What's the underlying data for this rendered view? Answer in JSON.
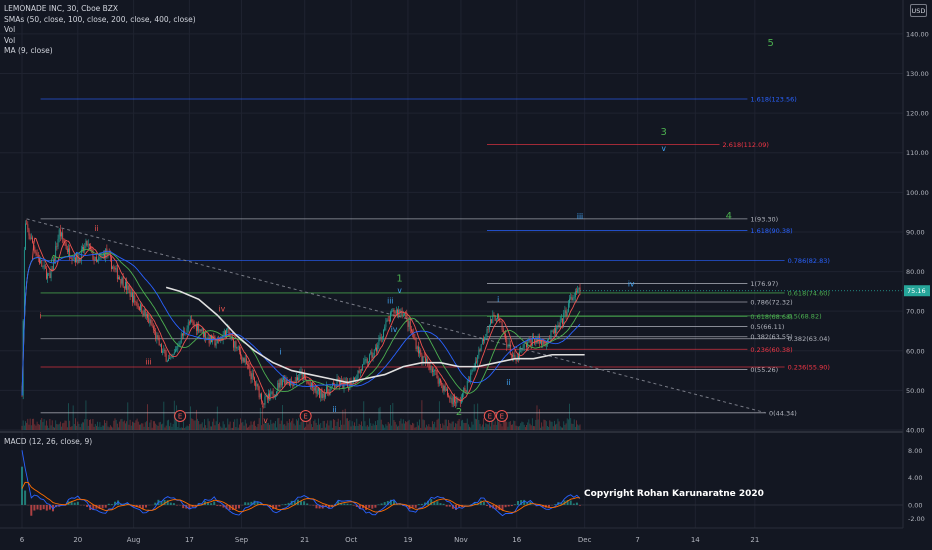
{
  "legend": {
    "title": "LEMONADE INC, 30, Cboe BZX",
    "sma": "SMAs (50, close, 100, close, 200, close, 400, close)",
    "vol1": "Vol",
    "vol2": "Vol",
    "ma": "MA (9, close)"
  },
  "macd_label": "MACD (12, 26, close, 9)",
  "currency": "USD",
  "copyright": "Copyright Rohan Karunaratne 2020",
  "colors": {
    "background": "#131722",
    "grid": "#1f2330",
    "up": "#26a69a",
    "down": "#ef5350",
    "fib_blue": "#2962ff",
    "fib_green": "#4caf50",
    "fib_red": "#f23645",
    "fib_white": "#b2b5be",
    "wave_green": "#4caf50",
    "wave_blue": "#42a5f5",
    "wave_red": "#ef5350",
    "price_tag": "#26a69a"
  },
  "chart_data": {
    "type": "candlestick",
    "symbol": "LEMONADE INC",
    "interval": "30",
    "ylim": [
      40,
      142
    ],
    "y_ticks": [
      "40.00",
      "50.00",
      "60.00",
      "70.00",
      "80.00",
      "90.00",
      "100.00",
      "110.00",
      "120.00",
      "130.00",
      "140.00"
    ],
    "x_ticks": [
      "6",
      "20",
      "Aug",
      "17",
      "Sep",
      "21",
      "Oct",
      "19",
      "Nov",
      "16",
      "Dec",
      "7",
      "14",
      "21"
    ],
    "last_price": "75.16",
    "macd_ylim": [
      -2.2,
      9.5
    ],
    "macd_ticks": [
      "8.00",
      "4.00",
      "0.00",
      "-2.00"
    ],
    "price_path": [
      [
        0,
        50
      ],
      [
        0.3,
        92
      ],
      [
        1,
        88
      ],
      [
        2,
        82
      ],
      [
        3,
        78
      ],
      [
        4,
        90
      ],
      [
        5,
        85
      ],
      [
        6,
        83
      ],
      [
        7,
        87
      ],
      [
        8,
        82
      ],
      [
        9,
        85
      ],
      [
        10,
        80
      ],
      [
        11,
        77
      ],
      [
        12,
        73
      ],
      [
        13,
        70
      ],
      [
        14,
        66
      ],
      [
        15,
        60
      ],
      [
        16,
        57
      ],
      [
        17,
        63
      ],
      [
        18,
        67
      ],
      [
        19,
        66
      ],
      [
        20,
        63
      ],
      [
        21,
        62
      ],
      [
        22,
        65
      ],
      [
        23,
        61
      ],
      [
        24,
        57
      ],
      [
        25,
        52
      ],
      [
        26,
        47
      ],
      [
        27,
        49
      ],
      [
        28,
        53
      ],
      [
        29,
        52
      ],
      [
        30,
        54
      ],
      [
        31,
        51
      ],
      [
        32,
        49
      ],
      [
        33,
        50
      ],
      [
        34,
        52
      ],
      [
        35,
        51
      ],
      [
        36,
        54
      ],
      [
        37,
        57
      ],
      [
        38,
        60
      ],
      [
        39,
        66
      ],
      [
        40,
        70
      ],
      [
        41,
        70
      ],
      [
        42,
        64
      ],
      [
        43,
        58
      ],
      [
        44,
        56
      ],
      [
        45,
        52
      ],
      [
        46,
        48
      ],
      [
        47,
        47
      ],
      [
        48,
        52
      ],
      [
        49,
        59
      ],
      [
        50,
        66
      ],
      [
        51,
        69
      ],
      [
        52,
        63
      ],
      [
        53,
        57
      ],
      [
        54,
        61
      ],
      [
        55,
        63
      ],
      [
        56,
        62
      ],
      [
        57,
        64
      ],
      [
        58,
        67
      ],
      [
        59,
        73
      ],
      [
        60,
        75.16
      ]
    ],
    "bars": 61,
    "sma_white": [
      [
        15.5,
        76
      ],
      [
        17,
        75
      ],
      [
        19,
        73
      ],
      [
        21,
        69
      ],
      [
        23,
        64
      ],
      [
        25,
        60
      ],
      [
        27,
        57
      ],
      [
        29,
        55
      ],
      [
        31,
        54
      ],
      [
        33,
        53
      ],
      [
        35,
        52
      ],
      [
        37,
        53
      ],
      [
        39,
        54
      ],
      [
        41,
        56
      ],
      [
        43,
        57
      ],
      [
        45,
        57
      ],
      [
        47,
        56
      ],
      [
        49,
        56
      ],
      [
        51,
        57
      ],
      [
        53,
        58
      ],
      [
        55,
        58
      ],
      [
        57,
        59
      ],
      [
        59,
        59
      ],
      [
        60.5,
        59
      ]
    ],
    "fib_levels": [
      {
        "label": "1.618(123.56)",
        "price": 123.56,
        "x0": 2,
        "x1": 78,
        "color": "blue"
      },
      {
        "label": "2.618(112.09)",
        "price": 112.09,
        "x0": 50,
        "x1": 75,
        "color": "red"
      },
      {
        "label": "1(93.30)",
        "price": 93.3,
        "x0": 2,
        "x1": 78,
        "color": "white"
      },
      {
        "label": "1.618(90.38)",
        "price": 90.38,
        "x0": 50,
        "x1": 78,
        "color": "blue"
      },
      {
        "label": "0.786(82.83)",
        "price": 82.83,
        "x0": 2,
        "x1": 82,
        "color": "blue"
      },
      {
        "label": "1(76.97)",
        "price": 76.97,
        "x0": 50,
        "x1": 78,
        "color": "white"
      },
      {
        "label": "0.618(74.60)",
        "price": 74.6,
        "x0": 2,
        "x1": 82,
        "color": "green"
      },
      {
        "label": "0.786(72.32)",
        "price": 72.32,
        "x0": 50,
        "x1": 78,
        "color": "white"
      },
      {
        "label": "0.618(68.68)",
        "price": 68.68,
        "x0": 50,
        "x1": 78,
        "color": "green"
      },
      {
        "label": "0.5(68.82)",
        "price": 68.82,
        "x0": 2,
        "x1": 82,
        "color": "green"
      },
      {
        "label": "0.5(66.11)",
        "price": 66.11,
        "x0": 50,
        "x1": 78,
        "color": "white"
      },
      {
        "label": "0.382(63.55)",
        "price": 63.55,
        "x0": 50,
        "x1": 78,
        "color": "white"
      },
      {
        "label": "0.382(63.04)",
        "price": 63.04,
        "x0": 2,
        "x1": 82,
        "color": "white"
      },
      {
        "label": "0.236(60.38)",
        "price": 60.38,
        "x0": 50,
        "x1": 78,
        "color": "red"
      },
      {
        "label": "0(55.26)",
        "price": 55.26,
        "x0": 50,
        "x1": 78,
        "color": "white"
      },
      {
        "label": "0.236(55.90)",
        "price": 55.9,
        "x0": 2,
        "x1": 82,
        "color": "red"
      },
      {
        "label": "0(44.34)",
        "price": 44.34,
        "x0": 2,
        "x1": 80,
        "color": "white"
      }
    ],
    "trendline": {
      "from": [
        0.5,
        93.3
      ],
      "to": [
        80,
        44.34
      ]
    },
    "wave_labels": [
      {
        "text": "5",
        "t": 80.5,
        "price": 137,
        "color": "green"
      },
      {
        "text": "3",
        "t": 69,
        "price": 114.5,
        "color": "green"
      },
      {
        "text": "v",
        "t": 69,
        "price": 110.5,
        "color": "blue"
      },
      {
        "text": "4",
        "t": 76,
        "price": 93.3,
        "color": "green"
      },
      {
        "text": "iii",
        "t": 60,
        "price": 93.3,
        "color": "blue"
      },
      {
        "text": "iv",
        "t": 65.5,
        "price": 76.2,
        "color": "blue"
      },
      {
        "text": "1",
        "t": 40.6,
        "price": 77.5,
        "color": "green"
      },
      {
        "text": "v",
        "t": 40.6,
        "price": 74.6,
        "color": "blue"
      },
      {
        "text": "iii",
        "t": 39.6,
        "price": 72.0,
        "color": "blue"
      },
      {
        "text": "iv",
        "t": 40.0,
        "price": 64.8,
        "color": "blue"
      },
      {
        "text": "i",
        "t": 27.8,
        "price": 59.0,
        "color": "blue"
      },
      {
        "text": "ii",
        "t": 33.6,
        "price": 44.5,
        "color": "blue"
      },
      {
        "text": "2",
        "t": 47.0,
        "price": 43.8,
        "color": "green"
      },
      {
        "text": "i",
        "t": 51.2,
        "price": 72.3,
        "color": "blue"
      },
      {
        "text": "ii",
        "t": 52.3,
        "price": 51.4,
        "color": "blue"
      },
      {
        "text": "i",
        "t": 2.0,
        "price": 68.2,
        "color": "red"
      },
      {
        "text": "ii",
        "t": 8.0,
        "price": 90.2,
        "color": "red"
      },
      {
        "text": "iii",
        "t": 13.6,
        "price": 56.6,
        "color": "red"
      },
      {
        "text": "iv",
        "t": 21.5,
        "price": 69.9,
        "color": "red"
      },
      {
        "text": "v",
        "t": 26.2,
        "price": 41.8,
        "color": "red"
      }
    ],
    "event_markers": [
      {
        "text": "E",
        "t": 17.0
      },
      {
        "text": "E",
        "t": 30.5
      },
      {
        "text": "E",
        "t": 50.3
      },
      {
        "text": "E",
        "t": 51.6
      }
    ]
  }
}
